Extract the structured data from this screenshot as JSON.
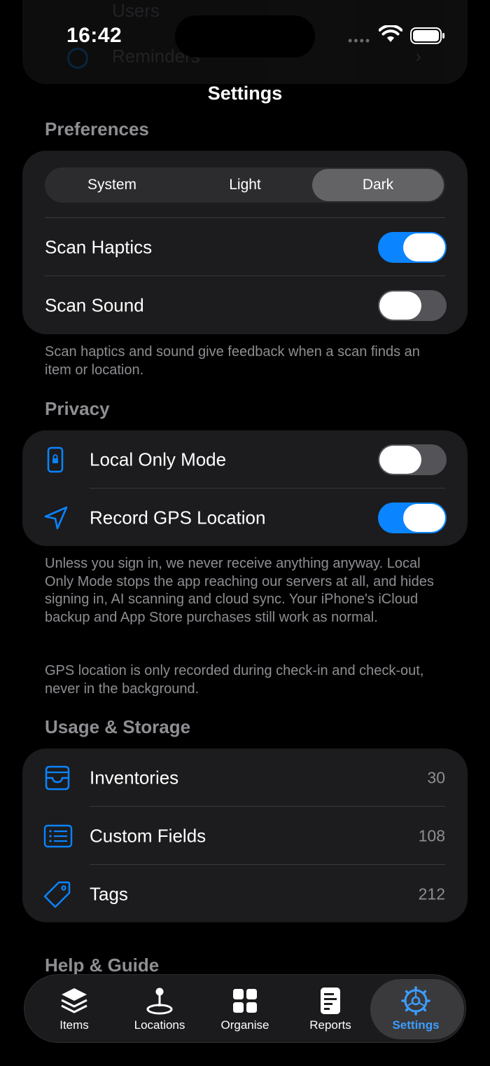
{
  "status_bar": {
    "time": "16:42"
  },
  "nav": {
    "title": "Settings"
  },
  "preferences": {
    "header": "Preferences",
    "appearance_options": [
      "System",
      "Light",
      "Dark"
    ],
    "appearance_selected": "Dark",
    "scan_haptics": {
      "label": "Scan Haptics",
      "on": true
    },
    "scan_sound": {
      "label": "Scan Sound",
      "on": false
    },
    "footer": "Scan haptics and sound give feedback when a scan finds an item or location."
  },
  "privacy": {
    "header": "Privacy",
    "local_only": {
      "label": "Local Only Mode",
      "icon": "lock-phone-icon",
      "on": false
    },
    "record_gps": {
      "label": "Record GPS Location",
      "icon": "location-arrow-icon",
      "on": true
    },
    "footer_1": "Unless you sign in, we never receive anything anyway. Local Only Mode stops the app reaching our servers at all, and hides signing in, AI scanning and cloud sync. Your iPhone's iCloud backup and App Store purchases still work as normal.",
    "footer_2": "GPS location is only recorded during check-in and check-out, never in the background."
  },
  "usage": {
    "header": "Usage & Storage",
    "items": [
      {
        "label": "Inventories",
        "value": "30",
        "icon": "tray-icon"
      },
      {
        "label": "Custom Fields",
        "value": "108",
        "icon": "list-icon"
      },
      {
        "label": "Tags",
        "value": "212",
        "icon": "tag-icon"
      }
    ]
  },
  "help": {
    "header": "Help & Guide"
  },
  "ghost_top": {
    "row1": "Users",
    "row2": "Reminders"
  },
  "tabbar": {
    "tabs": [
      {
        "label": "Items",
        "icon": "stack-icon"
      },
      {
        "label": "Locations",
        "icon": "map-pin-icon"
      },
      {
        "label": "Organise",
        "icon": "grid-icon"
      },
      {
        "label": "Reports",
        "icon": "document-icon"
      },
      {
        "label": "Settings",
        "icon": "gear-icon"
      }
    ],
    "active": "Settings"
  },
  "colors": {
    "accent": "#0a84ff",
    "background": "#000000",
    "card": "#1c1c1e",
    "secondary_text": "#8e8e93"
  }
}
